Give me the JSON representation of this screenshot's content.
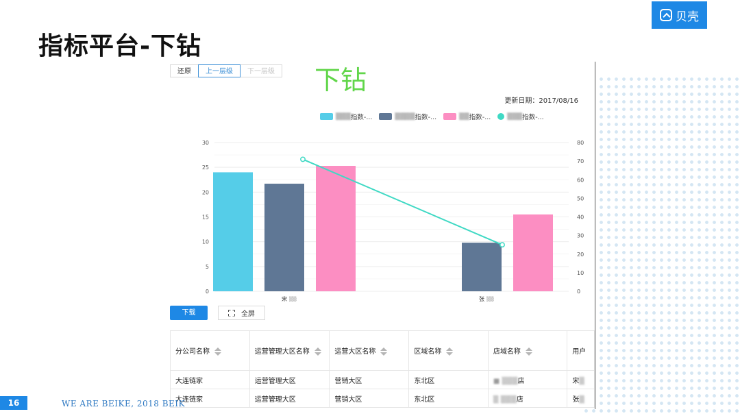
{
  "slide": {
    "title": "指标平台-下钻",
    "logo_text": "贝壳",
    "page_number": "16",
    "footer": "WE ARE BEIKE, 2018 BEIK"
  },
  "toolbar": {
    "restore_label": "还原",
    "up_level_label": "上一层级",
    "down_level_label": "下一层级"
  },
  "overlay_label": "下钻",
  "update_date": "更新日期：2017/08/16",
  "legend": [
    {
      "label": "指数-...",
      "color": "#55cde8",
      "shape": "rect"
    },
    {
      "label": "指数-...",
      "color": "#5f7795",
      "shape": "rect"
    },
    {
      "label": "指数-...",
      "color": "#fc8ec2",
      "shape": "rect"
    },
    {
      "label": "指数-...",
      "color": "#3fd9c4",
      "shape": "circle"
    }
  ],
  "chart_data": {
    "type": "bar",
    "categories": [
      "宋",
      "张"
    ],
    "series": [
      {
        "values": [
          24,
          0
        ],
        "color": "#55cde8"
      },
      {
        "values": [
          21.7,
          9.8
        ],
        "color": "#5f7795"
      },
      {
        "values": [
          25.3,
          15.5
        ],
        "color": "#fc8ec2"
      }
    ],
    "line_series": {
      "values": [
        71,
        25
      ],
      "axis": "right",
      "color": "#3fd9c4"
    },
    "y_left": {
      "ticks": [
        "0",
        "5",
        "10",
        "15",
        "20",
        "25",
        "30"
      ],
      "lim": [
        0,
        30
      ]
    },
    "y_right": {
      "ticks": [
        "0",
        "10",
        "20",
        "30",
        "40",
        "50",
        "60",
        "70",
        "80"
      ],
      "lim": [
        0,
        80
      ]
    },
    "grid": true
  },
  "actions": {
    "download_label": "下载",
    "fullscreen_label": "全屏"
  },
  "table": {
    "columns": [
      "分公司名称",
      "运营管理大区名称",
      "运营大区名称",
      "区域名称",
      "店域名称",
      "用户"
    ],
    "rows": [
      [
        "大连链家",
        "运营管理大区",
        "营销大区",
        "东北区",
        "店",
        "宋"
      ],
      [
        "大连链家",
        "运营管理大区",
        "营销大区",
        "东北区",
        "店",
        "张"
      ]
    ]
  }
}
